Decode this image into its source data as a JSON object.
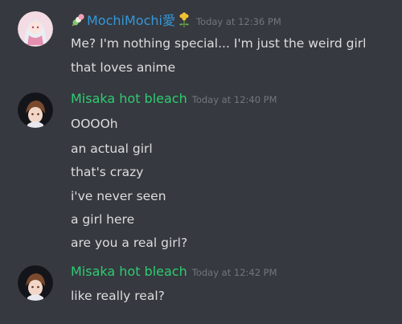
{
  "colors": {
    "background": "#36393f",
    "text": "#dcddde",
    "timestamp": "#72767d",
    "mochi_name": "#3498db",
    "misaka_name": "#2ecc71"
  },
  "messages": [
    {
      "username": "MochiMochi愛",
      "username_icons": [
        "dango-icon",
        "flower-icon"
      ],
      "timestamp": "Today at 12:36 PM",
      "lines": [
        "Me? I'm nothing special... I'm just the weird girl",
        "that loves anime"
      ]
    },
    {
      "username": "Misaka hot bleach",
      "timestamp": "Today at 12:40 PM",
      "lines": [
        "OOOOh",
        "an actual girl",
        "that's crazy",
        "i've never seen",
        "a girl here",
        "are you a real girl?"
      ]
    },
    {
      "username": "Misaka hot bleach",
      "timestamp": "Today at 12:42 PM",
      "lines": [
        "like really real?"
      ]
    }
  ]
}
